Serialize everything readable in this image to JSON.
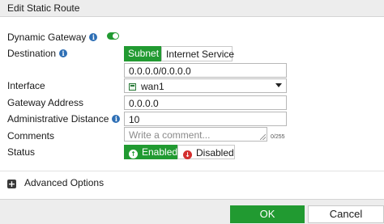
{
  "dialog": {
    "title": "Edit Static Route"
  },
  "fields": {
    "dynamic_gateway": {
      "label": "Dynamic Gateway",
      "enabled": true
    },
    "destination": {
      "label": "Destination",
      "options": [
        "Subnet",
        "Internet Service"
      ],
      "selected": "Subnet",
      "value": "0.0.0.0/0.0.0.0"
    },
    "interface": {
      "label": "Interface",
      "value": "wan1"
    },
    "gateway_address": {
      "label": "Gateway Address",
      "value": "0.0.0.0"
    },
    "admin_distance": {
      "label": "Administrative Distance",
      "value": "10"
    },
    "comments": {
      "label": "Comments",
      "placeholder": "Write a comment...",
      "counter": "0/255"
    },
    "status": {
      "label": "Status",
      "enabled_label": "Enabled",
      "disabled_label": "Disabled",
      "selected": "Enabled"
    }
  },
  "advanced": {
    "label": "Advanced Options"
  },
  "footer": {
    "ok_label": "OK",
    "cancel_label": "Cancel"
  },
  "colors": {
    "accent": "#219a31",
    "info": "#2e6fb5",
    "danger": "#d32f2f",
    "chrome": "#ededed"
  },
  "icons": [
    "info-icon",
    "toggle-switch",
    "interface-port-icon",
    "chevron-down-icon",
    "check-circle-icon",
    "x-circle-icon",
    "plus-square-icon"
  ]
}
